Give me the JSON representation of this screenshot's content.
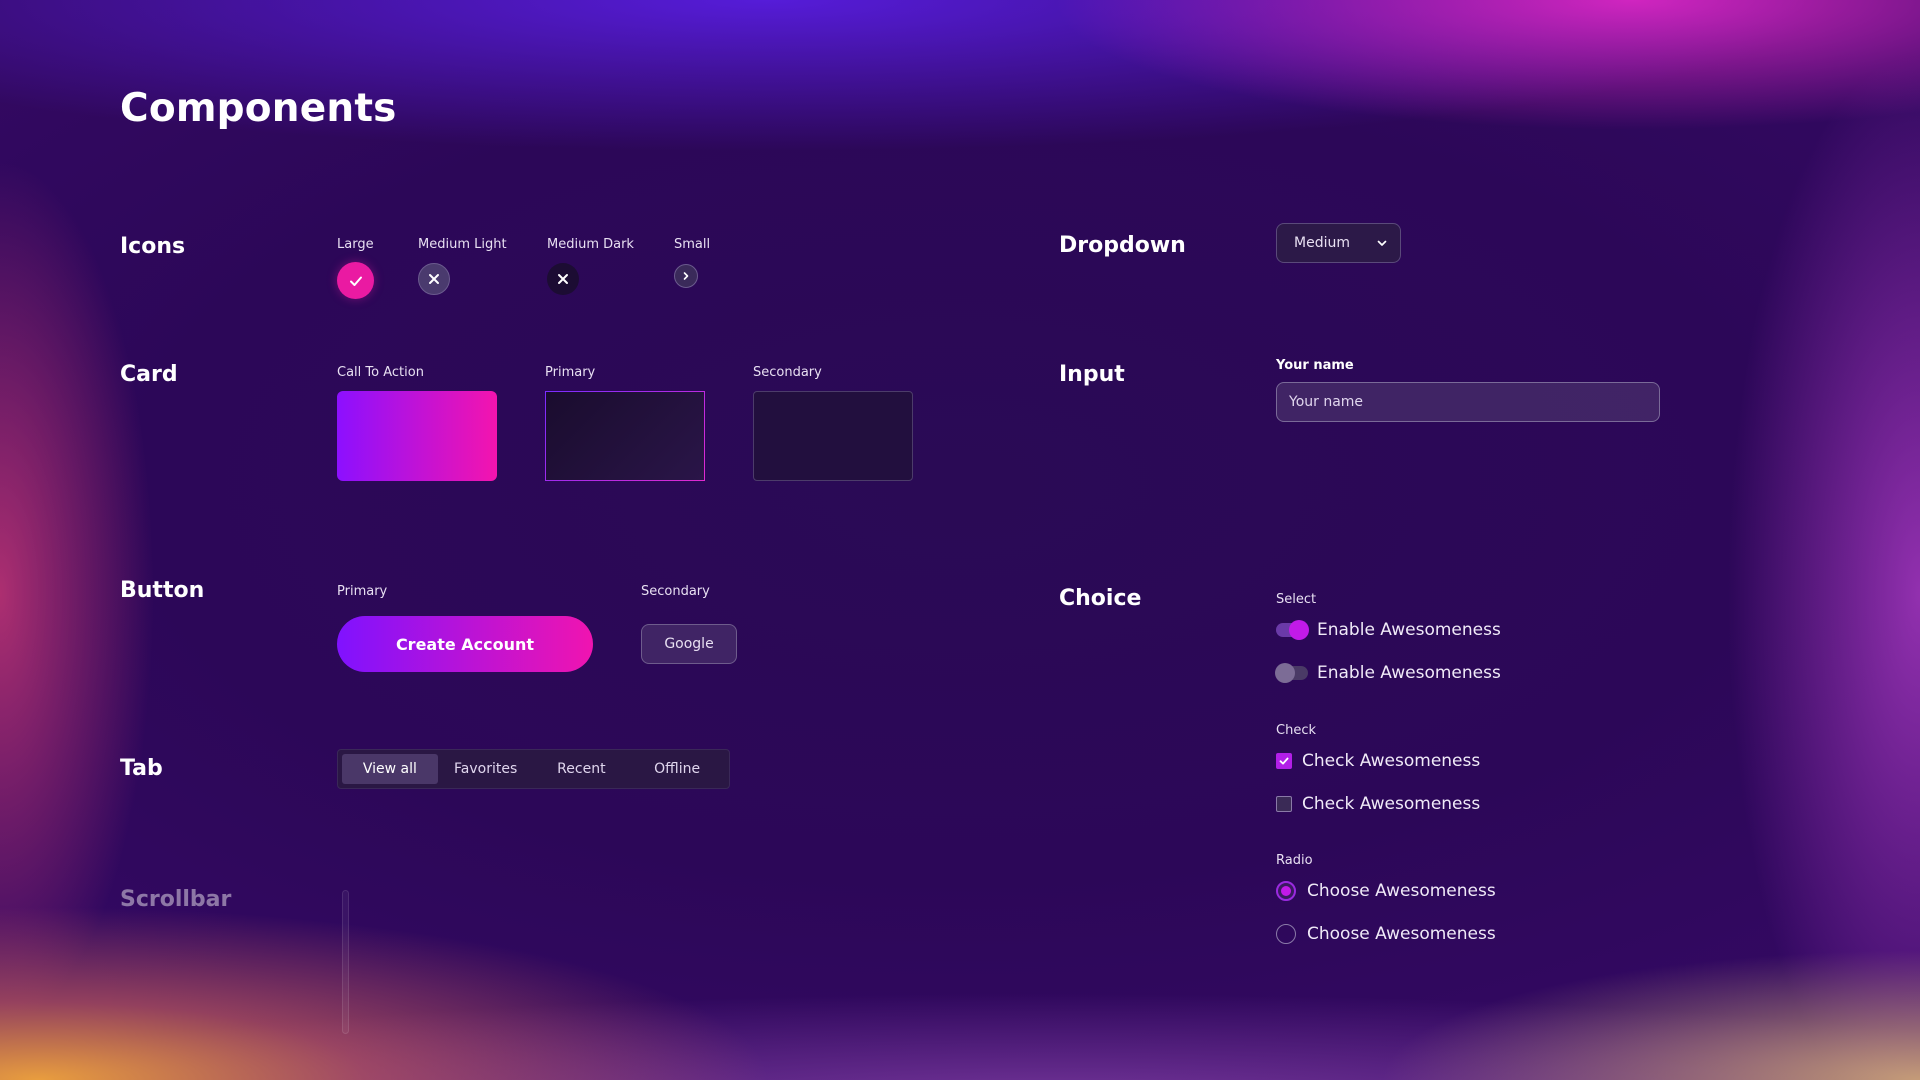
{
  "page": {
    "title": "Components"
  },
  "sections": {
    "icons": "Icons",
    "card": "Card",
    "button": "Button",
    "tab": "Tab",
    "scrollbar": "Scrollbar",
    "dropdown": "Dropdown",
    "input": "Input",
    "choice": "Choice"
  },
  "icons": [
    {
      "label": "Large",
      "icon": "check-icon",
      "variant": "large"
    },
    {
      "label": "Medium Light",
      "icon": "close-icon",
      "variant": "medium-light"
    },
    {
      "label": "Medium Dark",
      "icon": "close-icon",
      "variant": "medium-dark"
    },
    {
      "label": "Small",
      "icon": "chevron-right-icon",
      "variant": "small"
    }
  ],
  "cards": [
    {
      "label": "Call To Action"
    },
    {
      "label": "Primary"
    },
    {
      "label": "Secondary"
    }
  ],
  "buttons": {
    "primary_label": "Primary",
    "primary_text": "Create Account",
    "secondary_label": "Secondary",
    "secondary_text": "Google"
  },
  "tabs": {
    "items": [
      "View all",
      "Favorites",
      "Recent",
      "Offline"
    ],
    "active": "View all"
  },
  "dropdown": {
    "value": "Medium",
    "icon": "chevron-down-icon"
  },
  "input": {
    "label": "Your name",
    "placeholder": "Your name",
    "value": ""
  },
  "choice": {
    "select_label": "Select",
    "toggles": [
      {
        "text": "Enable Awesomeness",
        "on": true
      },
      {
        "text": "Enable Awesomeness",
        "on": false
      }
    ],
    "check_label": "Check",
    "checks": [
      {
        "text": "Check Awesomeness",
        "checked": true
      },
      {
        "text": "Check Awesomeness",
        "checked": false
      }
    ],
    "radio_label": "Radio",
    "radios": [
      {
        "text": "Choose Awesomeness",
        "selected": true
      },
      {
        "text": "Choose Awesomeness",
        "selected": false
      }
    ]
  },
  "colors": {
    "accent_pink": "#ea1aa2",
    "accent_purple": "#8012ff",
    "toggle_on": "#c21ae8",
    "background": "#2c0758"
  }
}
